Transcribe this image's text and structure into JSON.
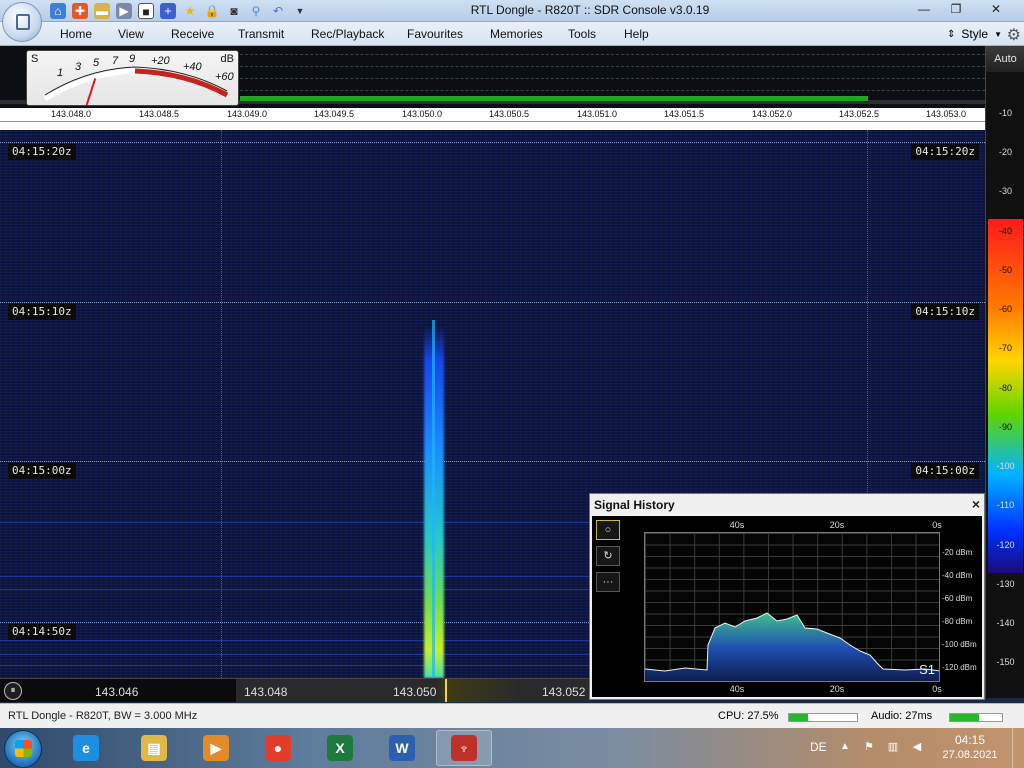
{
  "window": {
    "title": "RTL Dongle - R820T :: SDR Console v3.0.19"
  },
  "ribbon": {
    "tabs": [
      "Home",
      "View",
      "Receive",
      "Transmit",
      "Rec/Playback",
      "Favourites",
      "Memories",
      "Tools",
      "Help"
    ],
    "style_label": "Style"
  },
  "s_meter": {
    "s_label": "S",
    "db_label": "dB",
    "scale_s": [
      "1",
      "3",
      "5",
      "7",
      "9"
    ],
    "scale_db": [
      "+20",
      "+40",
      "+60"
    ]
  },
  "spectrum": {
    "freq_ticks": [
      "143.048.0",
      "143.048.5",
      "143.049.0",
      "143.049.5",
      "143.050.0",
      "143.050.5",
      "143.051.0",
      "143.051.5",
      "143.052.0",
      "143.052.5",
      "143.053.0"
    ],
    "signal_color": "#1ea61e"
  },
  "db_scale": {
    "auto_label": "Auto",
    "labels": [
      "-10",
      "-20",
      "-30",
      "-40",
      "-50",
      "-60",
      "-70",
      "-80",
      "-90",
      "-100",
      "-110",
      "-120",
      "-130",
      "-140",
      "-150"
    ]
  },
  "waterfall": {
    "timestamps": [
      "04:15:20z",
      "04:15:10z",
      "04:15:00z",
      "04:14:50z"
    ]
  },
  "signal_history": {
    "title": "Signal History",
    "close_label": "×",
    "time_labels": [
      "40s",
      "20s",
      "0s"
    ],
    "y_labels": [
      "-20 dBm",
      "-40 dBm",
      "-60 dBm",
      "-80 dBm",
      "-100 dBm",
      "-120 dBm"
    ],
    "s_indicator": "S1",
    "tools": [
      "○",
      "↻",
      "···"
    ]
  },
  "bottom_ruler": {
    "labels": [
      "143.046",
      "143.048",
      "143.050",
      "143.052"
    ]
  },
  "status": {
    "text": "RTL Dongle - R820T, BW = 3.000 MHz",
    "cpu": "CPU: 27.5%",
    "cpu_fraction": 0.275,
    "audio": "Audio: 27ms",
    "audio_fraction": 0.55
  },
  "taskbar": {
    "apps": [
      {
        "name": "internet-explorer",
        "glyph": "e",
        "color": "#1d8fe0"
      },
      {
        "name": "file-explorer",
        "glyph": "▤",
        "color": "#e1b94a"
      },
      {
        "name": "media-player",
        "glyph": "▶",
        "color": "#e38b2a"
      },
      {
        "name": "chrome",
        "glyph": "●",
        "color": "#e23c2a"
      },
      {
        "name": "excel",
        "glyph": "X",
        "color": "#1e7a3c"
      },
      {
        "name": "word",
        "glyph": "W",
        "color": "#2b5fb0"
      },
      {
        "name": "sdr-console",
        "glyph": "♆",
        "color": "#c0302a"
      }
    ],
    "language": "DE",
    "time": "04:15",
    "date": "27.08.2021"
  }
}
